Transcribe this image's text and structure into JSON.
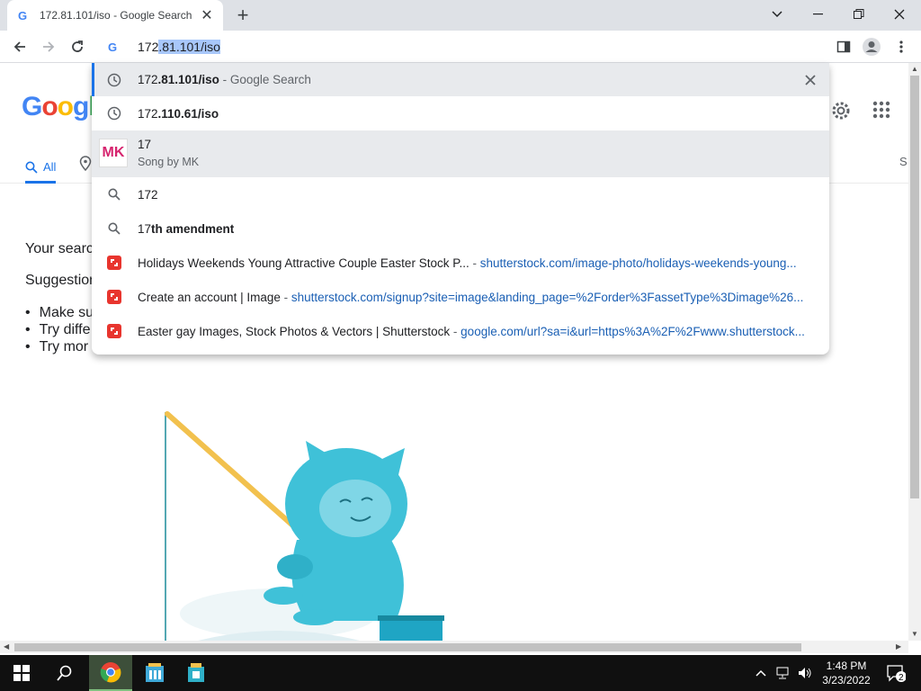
{
  "browser": {
    "tab_title": "172.81.101/iso - Google Search",
    "tab_close": "✕",
    "new_tab": "+",
    "omnibox": {
      "typed": "172",
      "selected": ".81.101/iso"
    }
  },
  "page": {
    "logo": "Google",
    "tab_all": "All",
    "tab_partial_right": "S",
    "line_search": "Your searc",
    "line_suggestions": "Suggestion",
    "bullets": [
      "Make su",
      "Try diffe",
      "Try mor"
    ]
  },
  "dropdown": {
    "items": [
      {
        "type": "history",
        "prefix": "172",
        "bold": ".81.101/iso",
        "suffix": " - Google Search",
        "removable": true
      },
      {
        "type": "history",
        "prefix": "172",
        "bold": ".110.61/iso"
      },
      {
        "type": "entity",
        "title": "17",
        "subtitle": "Song by MK",
        "thumb_text": "MK"
      },
      {
        "type": "search",
        "prefix": "172",
        "bold": ""
      },
      {
        "type": "search",
        "prefix": "17",
        "bold": "th amendment"
      },
      {
        "type": "bookmark",
        "title": "Holidays Weekends Young Attractive Couple Easter Stock P...",
        "url": "shutterstock.com/image-photo/holidays-weekends-young..."
      },
      {
        "type": "bookmark",
        "title": "Create an account | Image",
        "url": "shutterstock.com/signup?site=image&landing_page=%2Forder%3FassetType%3Dimage%26..."
      },
      {
        "type": "bookmark",
        "title": "Easter gay Images, Stock Photos & Vectors | Shutterstock",
        "url": "google.com/url?sa=i&url=https%3A%2F%2Fwww.shutterstock..."
      }
    ],
    "separator": " - "
  },
  "taskbar": {
    "time": "1:48 PM",
    "date": "3/23/2022",
    "notification_count": "2"
  },
  "colors": {
    "accent": "#1a73e8",
    "url": "#1a5fb4",
    "illustration_teal": "#3fc1d8",
    "rod": "#f2c14e"
  }
}
